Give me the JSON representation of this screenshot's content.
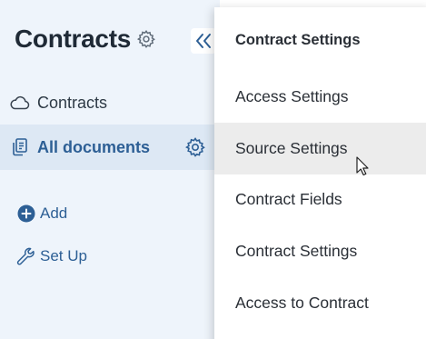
{
  "sidebar": {
    "title": "Contracts",
    "title_icon": "gear-icon",
    "collapse_icon": "double-chevron-left-icon",
    "items": [
      {
        "label": "Contracts",
        "icon": "cloud-icon"
      },
      {
        "label": "All documents",
        "icon": "documents-icon",
        "active": true,
        "trailing_icon": "gear-icon"
      }
    ],
    "actions": [
      {
        "label": "Add",
        "icon": "plus-circle-icon"
      },
      {
        "label": "Set Up",
        "icon": "wrench-icon"
      }
    ]
  },
  "menu": {
    "header": "Contract Settings",
    "items": [
      {
        "label": "Access Settings"
      },
      {
        "label": "Source Settings",
        "hovered": true
      },
      {
        "label": "Contract Fields"
      },
      {
        "label": "Contract Settings"
      },
      {
        "label": "Access to Contract"
      }
    ]
  },
  "colors": {
    "sidebar_bg": "#eef4fb",
    "active_item_bg": "#dde8f4",
    "accent": "#2d5f95",
    "menu_hover_bg": "#ececec"
  }
}
